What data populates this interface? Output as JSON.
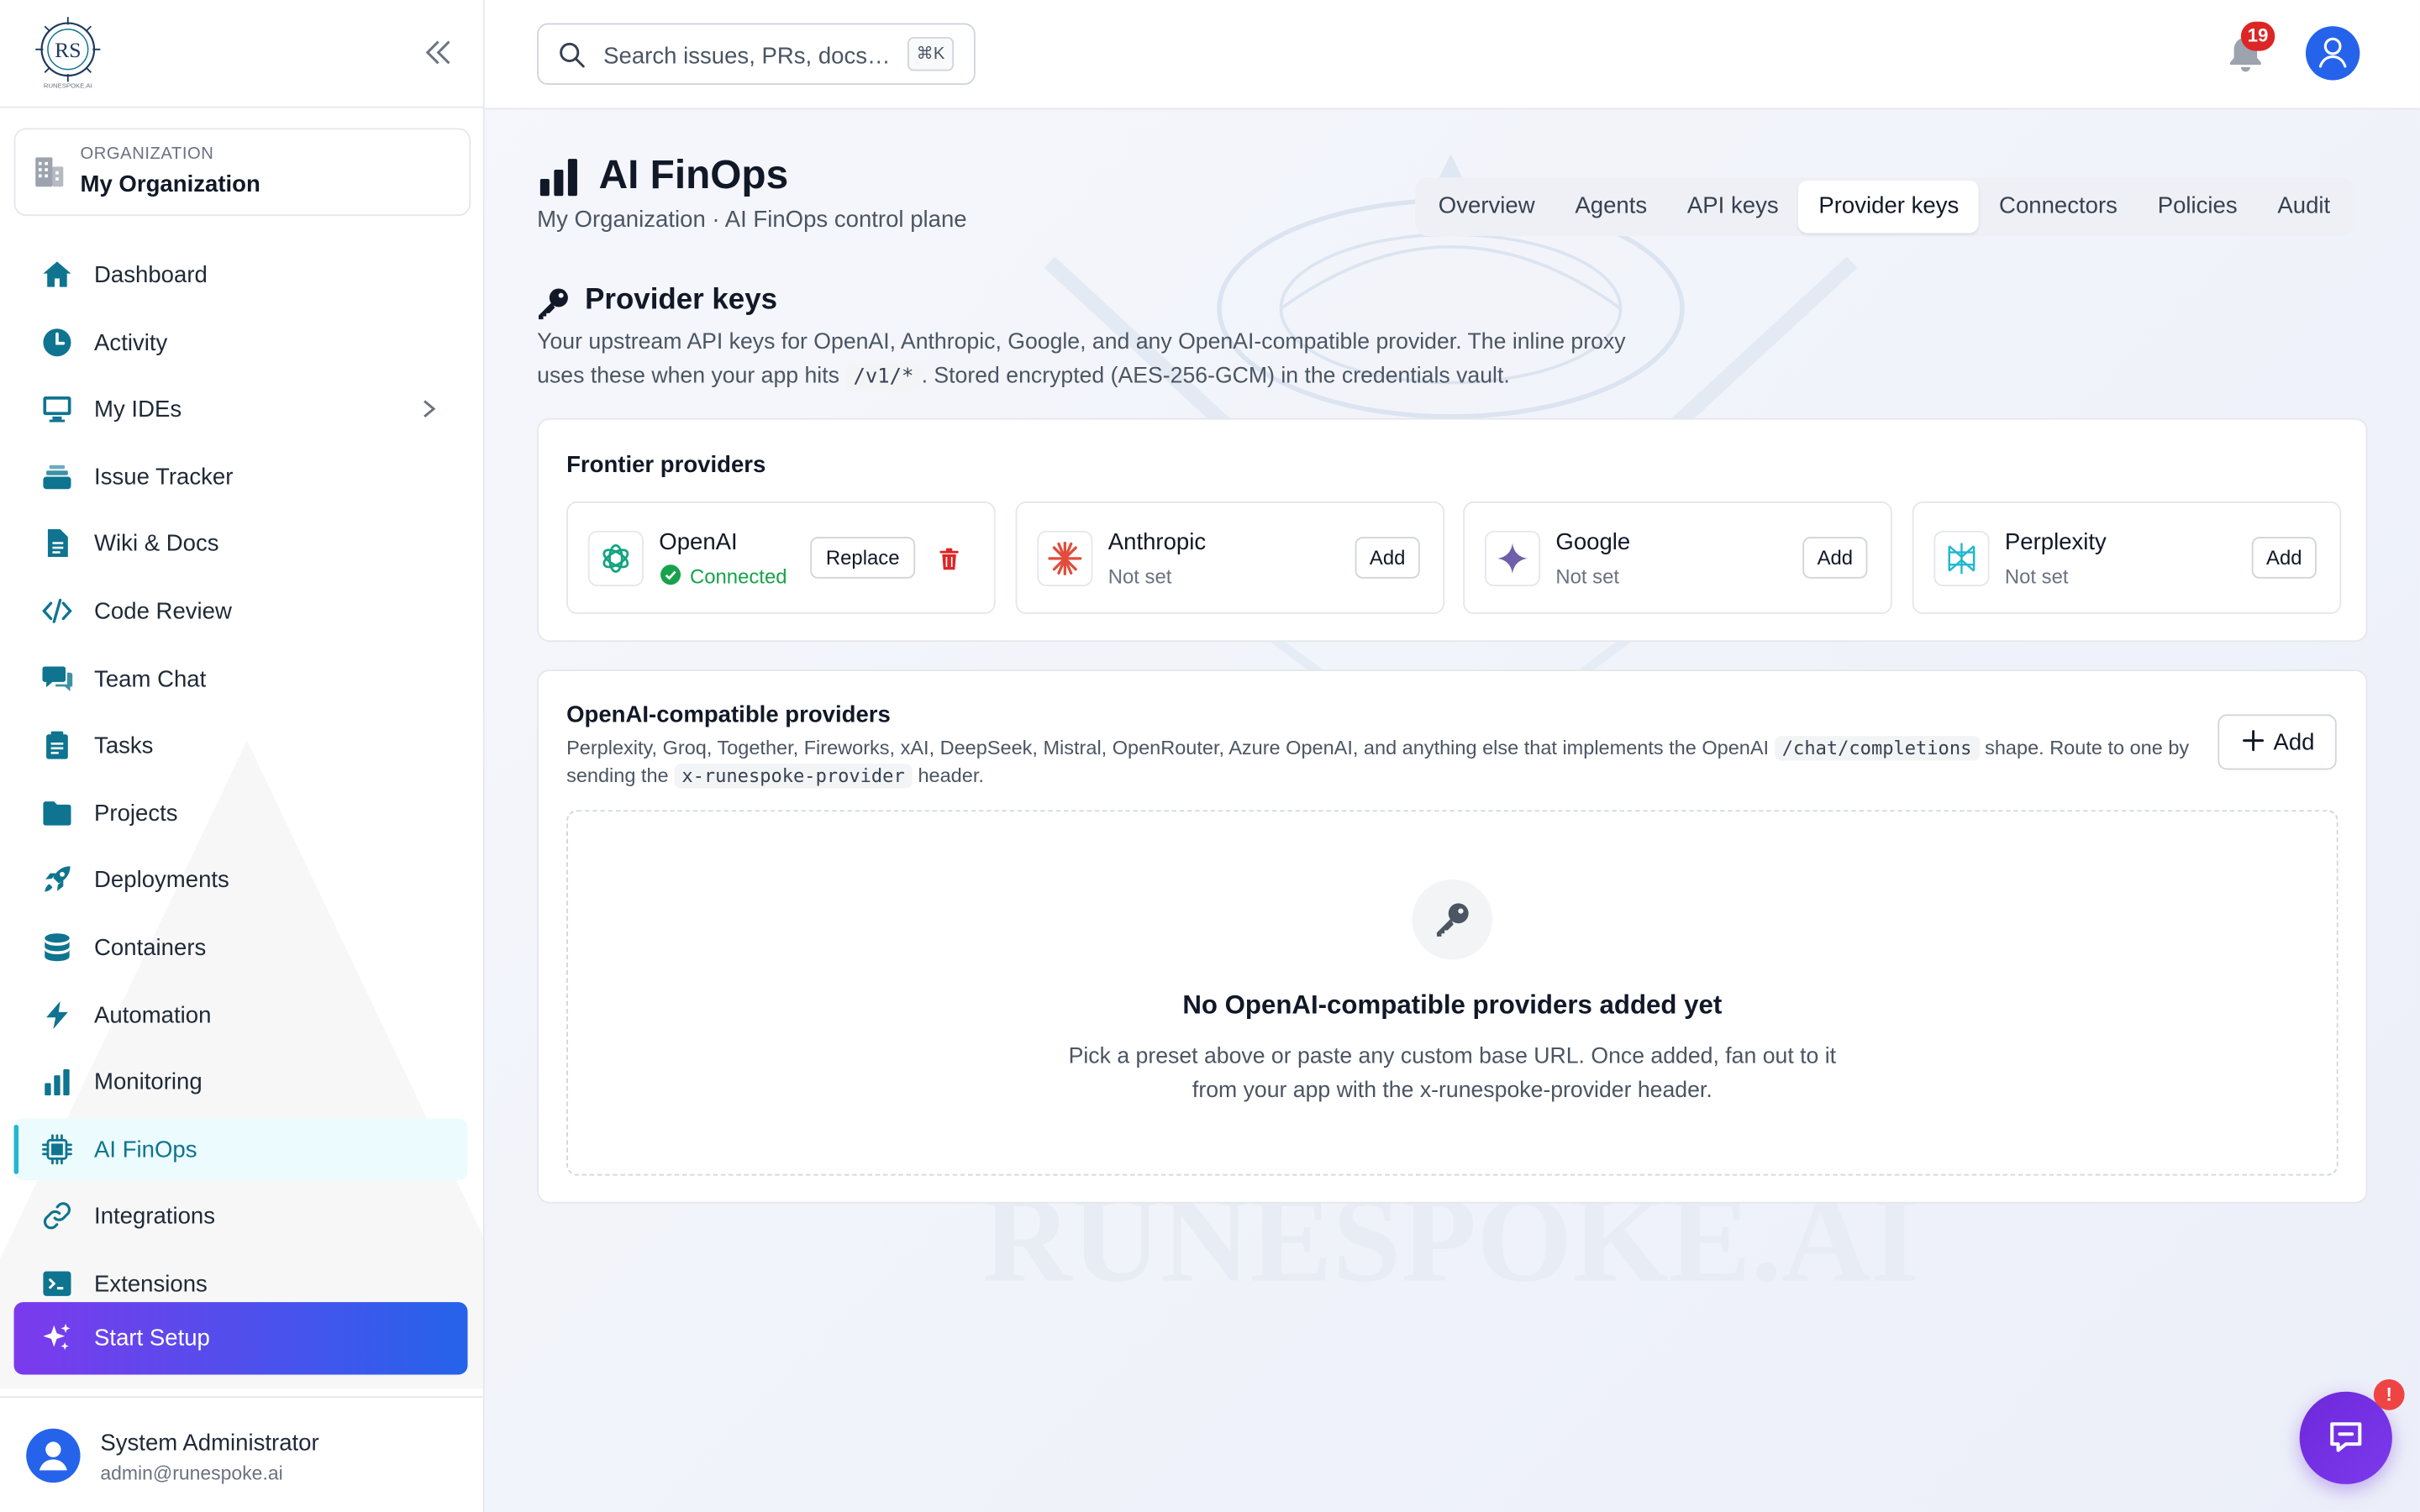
{
  "brand": {
    "logo_text": "RS",
    "logo_caption": "RUNESPOKE.AI"
  },
  "org": {
    "label": "ORGANIZATION",
    "name": "My Organization"
  },
  "sidebar": {
    "items": [
      {
        "label": "Dashboard",
        "icon": "home-icon"
      },
      {
        "label": "Activity",
        "icon": "clock-icon"
      },
      {
        "label": "My IDEs",
        "icon": "monitor-icon",
        "has_submenu": true
      },
      {
        "label": "Issue Tracker",
        "icon": "stack-icon"
      },
      {
        "label": "Wiki & Docs",
        "icon": "document-icon"
      },
      {
        "label": "Code Review",
        "icon": "code-icon"
      },
      {
        "label": "Team Chat",
        "icon": "chat-icon"
      },
      {
        "label": "Tasks",
        "icon": "clipboard-icon"
      },
      {
        "label": "Projects",
        "icon": "folder-icon"
      },
      {
        "label": "Deployments",
        "icon": "rocket-icon"
      },
      {
        "label": "Containers",
        "icon": "database-icon"
      },
      {
        "label": "Automation",
        "icon": "bolt-icon"
      },
      {
        "label": "Monitoring",
        "icon": "bar-chart-icon"
      },
      {
        "label": "AI FinOps",
        "icon": "chip-icon",
        "active": true
      },
      {
        "label": "Integrations",
        "icon": "link-icon"
      },
      {
        "label": "Extensions",
        "icon": "terminal-icon"
      }
    ],
    "setup_label": "Start Setup"
  },
  "user": {
    "name": "System Administrator",
    "email": "admin@runespoke.ai"
  },
  "topbar": {
    "search_placeholder": "Search issues, PRs, docs…",
    "shortcut": "⌘K",
    "notification_count": "19"
  },
  "page": {
    "title": "AI FinOps",
    "subtitle": "My Organization · AI FinOps control plane",
    "tabs": [
      {
        "label": "Overview"
      },
      {
        "label": "Agents"
      },
      {
        "label": "API keys"
      },
      {
        "label": "Provider keys",
        "active": true
      },
      {
        "label": "Connectors"
      },
      {
        "label": "Policies"
      },
      {
        "label": "Audit"
      }
    ]
  },
  "provider_keys": {
    "title": "Provider keys",
    "desc_part1": "Your upstream API keys for OpenAI, Anthropic, Google, and any OpenAI-compatible provider. The inline proxy uses these when your app hits",
    "desc_code": "/v1/*",
    "desc_part2": ". Stored encrypted (AES-256-GCM) in the credentials vault."
  },
  "frontier": {
    "title": "Frontier providers",
    "providers": [
      {
        "name": "OpenAI",
        "status": "Connected",
        "action": "Replace"
      },
      {
        "name": "Anthropic",
        "status": "Not set",
        "action": "Add"
      },
      {
        "name": "Google",
        "status": "Not set",
        "action": "Add"
      },
      {
        "name": "Perplexity",
        "status": "Not set",
        "action": "Add"
      }
    ]
  },
  "compat": {
    "title": "OpenAI-compatible providers",
    "desc_part1": "Perplexity, Groq, Together, Fireworks, xAI, DeepSeek, Mistral, OpenRouter, Azure OpenAI, and anything else that implements the OpenAI",
    "desc_code1": "/chat/completions",
    "desc_part2": "shape. Route to one by sending the",
    "desc_code2": "x-runespoke-provider",
    "desc_part3": "header.",
    "add_label": "Add",
    "empty_title": "No OpenAI-compatible providers added yet",
    "empty_text": "Pick a preset above or paste any custom base URL. Once added, fan out to it from your app with the x-runespoke-provider header."
  },
  "watermark_text": "RUNESPOKE.AI",
  "chat": {
    "badge": "!"
  },
  "colors": {
    "accent": "#0e7490",
    "active_bg": "#ecfbfd",
    "setup_gradient_start": "#7c3aed",
    "setup_gradient_end": "#2563eb",
    "danger": "#dc2626",
    "success": "#16a34a"
  }
}
